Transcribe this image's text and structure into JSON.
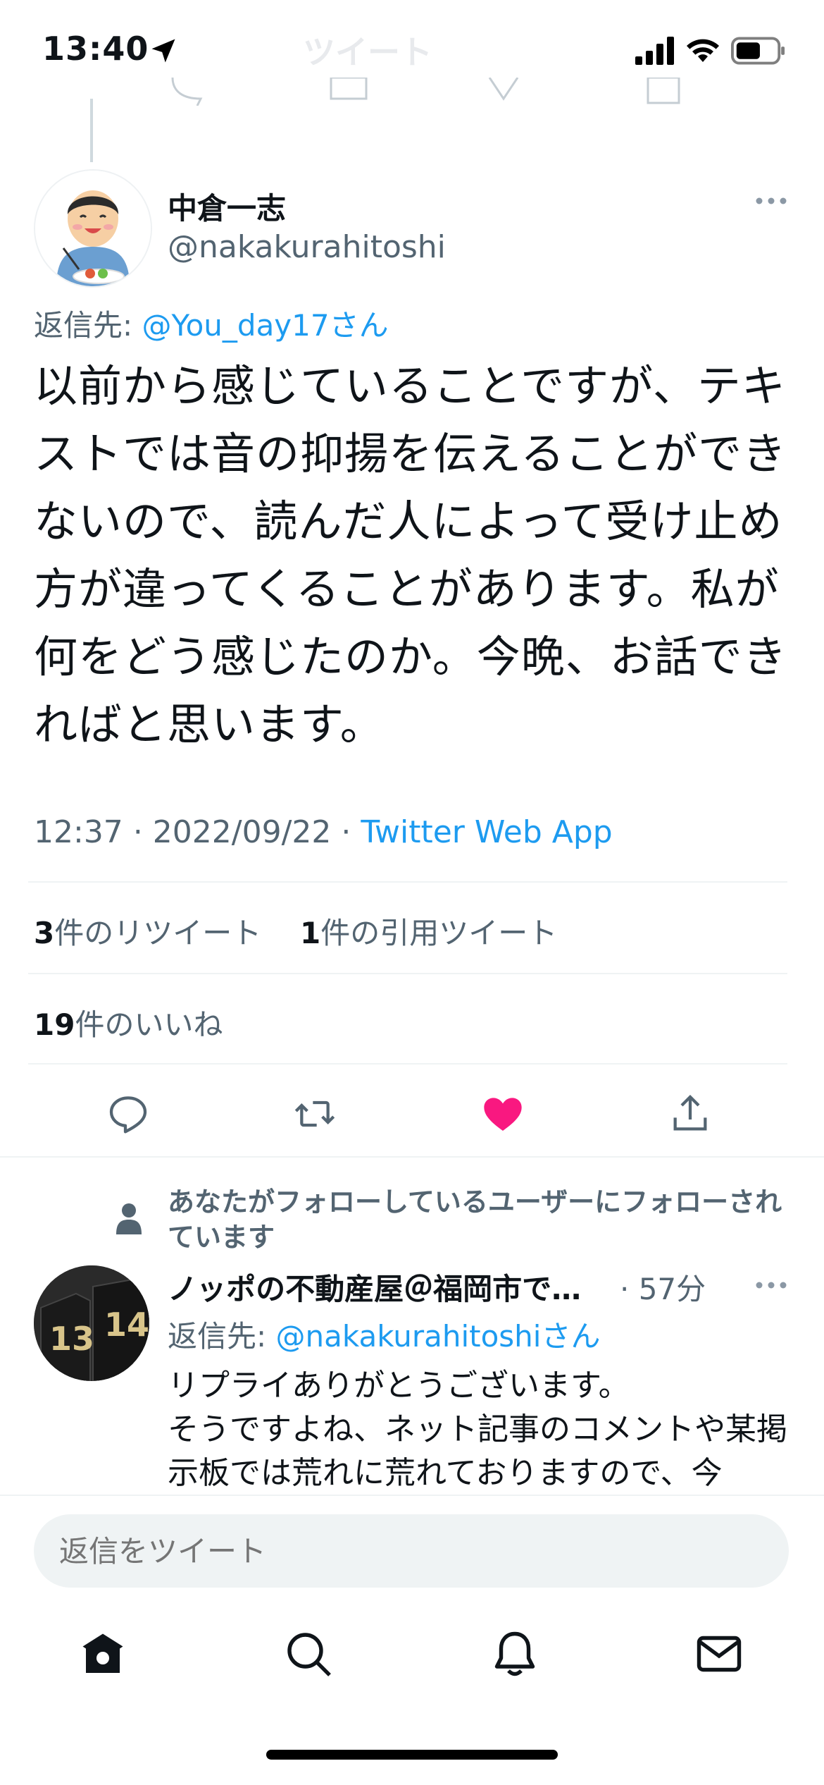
{
  "status_bar": {
    "time": "13:40",
    "header_faded": "ツイート"
  },
  "tweet": {
    "author_name": "中倉一志",
    "author_handle": "@nakakurahitoshi",
    "reply_to_prefix": "返信先: ",
    "reply_to_handle": "@You_day17さん",
    "text": "以前から感じていることですが、テキストでは音の抑揚を伝えることができないので、読んだ人によって受け止め方が違ってくることがあります。私が何をどう感じたのか。今晩、お話できればと思います。",
    "time": "12:37",
    "date": "2022/09/22",
    "source": "Twitter Web App",
    "retweets_count": "3",
    "retweets_label": "件のリツイート",
    "quotes_count": "1",
    "quotes_label": "件の引用ツイート",
    "likes_count": "19",
    "likes_label": "件のいいね",
    "liked": true
  },
  "reply": {
    "social_context": "あなたがフォローしているユーザーにフォローされています",
    "author_name": "ノッポの不動産屋＠福岡市で…",
    "time": "· 57分",
    "reply_to_prefix": "返信先: ",
    "reply_to_handle": "@nakakurahitoshiさん",
    "text_line1": "リプライありがとうございます。",
    "text_line2": "そうですよね、ネット記事のコメントや某掲示板では荒れに荒れておりますので、今"
  },
  "compose": {
    "placeholder": "返信をツイート"
  },
  "colors": {
    "accent": "#1d9bf0",
    "like": "#f91880",
    "secondary_text": "#536471"
  },
  "icons": [
    "location-arrow-icon",
    "signal-icon",
    "wifi-icon",
    "battery-icon",
    "reply-icon",
    "retweet-icon",
    "heart-icon",
    "share-icon",
    "person-icon",
    "more-icon",
    "home-icon",
    "search-icon",
    "bell-icon",
    "mail-icon"
  ]
}
